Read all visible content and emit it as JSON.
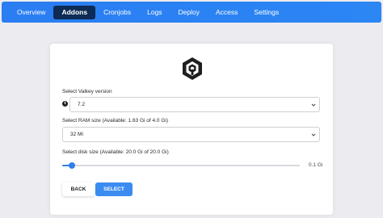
{
  "nav": {
    "tabs": [
      {
        "label": "Overview"
      },
      {
        "label": "Addons"
      },
      {
        "label": "Cronjobs"
      },
      {
        "label": "Logs"
      },
      {
        "label": "Deploy"
      },
      {
        "label": "Access"
      },
      {
        "label": "Settings"
      }
    ],
    "active_tab": "Addons"
  },
  "form": {
    "logo_icon": "valkey-logo-icon",
    "version_label": "Select Valkey version",
    "version_value": "7.2",
    "info_icon": "info-icon",
    "ram_label": "Select RAM size (Available: 1.63 Gi of 4.0 Gi)",
    "ram_value": "32 Mi",
    "disk_label": "Select disk size (Available: 20.0 Gi of 20.0 Gi)",
    "disk_slider_fraction": 0.04,
    "disk_value": "0.1 Gi",
    "back_label": "BACK",
    "select_label": "SELECT"
  },
  "colors": {
    "nav_bg": "#2a7df2",
    "active_tab_bg": "#0d2b55",
    "accent": "#2f80ed"
  }
}
